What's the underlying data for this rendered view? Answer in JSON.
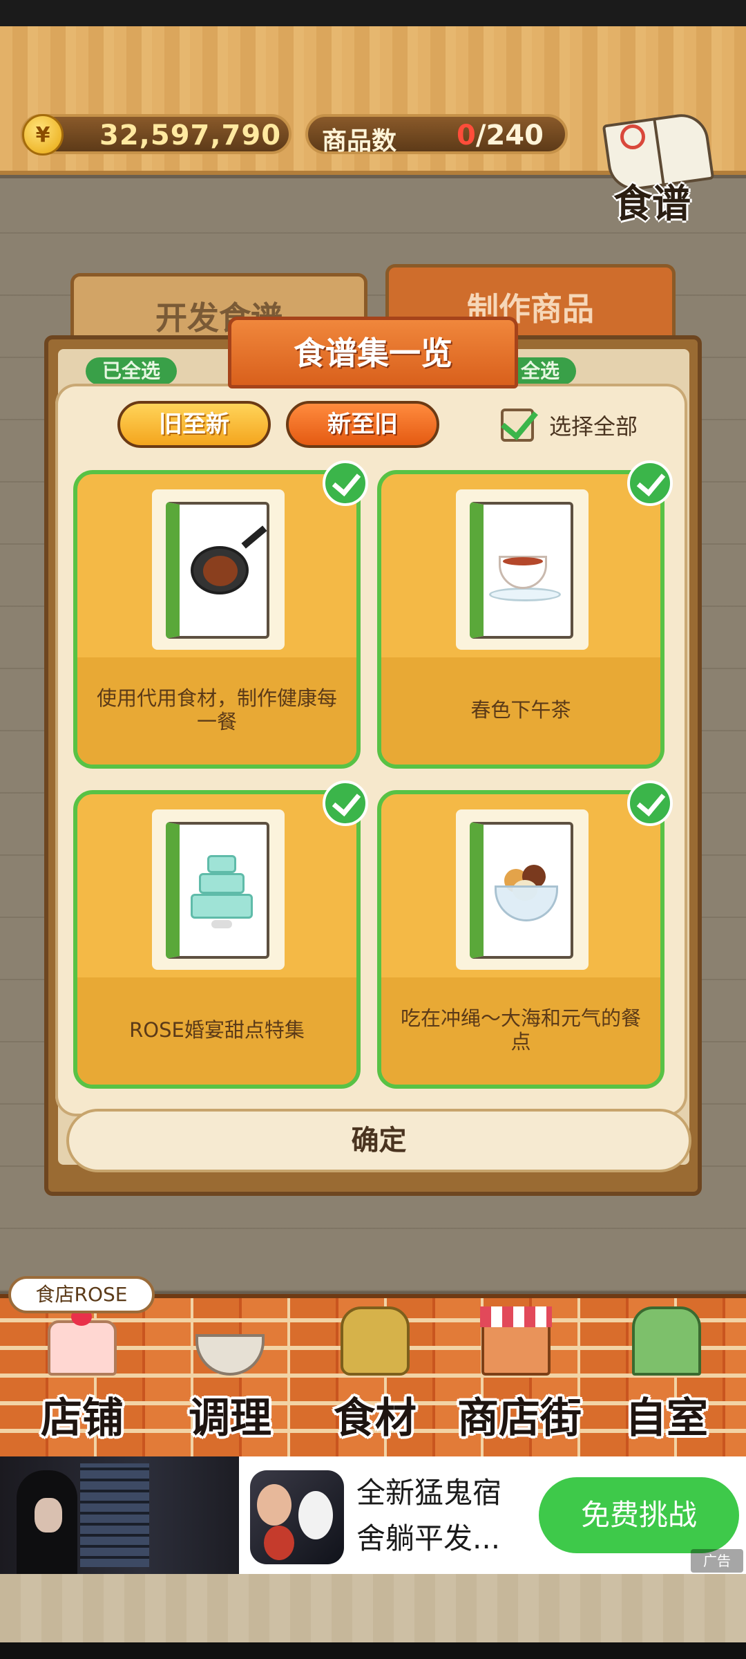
{
  "status": {
    "currency_symbol": "¥",
    "money": "32,597,790",
    "goods_label": "商品数",
    "goods_owned": "0",
    "goods_total": "/240"
  },
  "recipe_book": {
    "label": "食谱"
  },
  "tabs": {
    "develop": "开发食谱",
    "make": "制作商品",
    "chip_left": "已全选",
    "chip_right": "全选"
  },
  "dialog": {
    "title": "食谱集一览",
    "sort_old_to_new": "旧至新",
    "sort_new_to_old": "新至旧",
    "select_all_label": "选择全部",
    "select_all_checked": true,
    "confirm": "确定",
    "cards": [
      {
        "title": "使用代用食材，制作健康每一餐",
        "checked": true,
        "icon": "frying-pan-dish-icon"
      },
      {
        "title": "春色下午茶",
        "checked": true,
        "icon": "teacup-icon"
      },
      {
        "title": "ROSE婚宴甜点特集",
        "checked": true,
        "icon": "wedding-cake-icon"
      },
      {
        "title": "吃在冲绳～大海和元气的餐点",
        "checked": true,
        "icon": "dessert-bowl-icon"
      }
    ]
  },
  "shop_name": "食店ROSE",
  "nav": [
    {
      "label": "店铺",
      "icon": "cake-icon"
    },
    {
      "label": "调理",
      "icon": "mixing-bowl-icon"
    },
    {
      "label": "食材",
      "icon": "sack-icon"
    },
    {
      "label": "商店街",
      "icon": "shop-icon"
    },
    {
      "label": "自室",
      "icon": "staff-door-icon"
    }
  ],
  "ad": {
    "line1": "全新猛鬼宿",
    "line2": "舍躺平发...",
    "cta": "免费挑战",
    "tag": "广告"
  },
  "colors": {
    "accent_orange": "#e45a12",
    "check_green": "#3bb54a",
    "card_yellow": "#f4b946",
    "cta_green": "#3ec94a"
  }
}
